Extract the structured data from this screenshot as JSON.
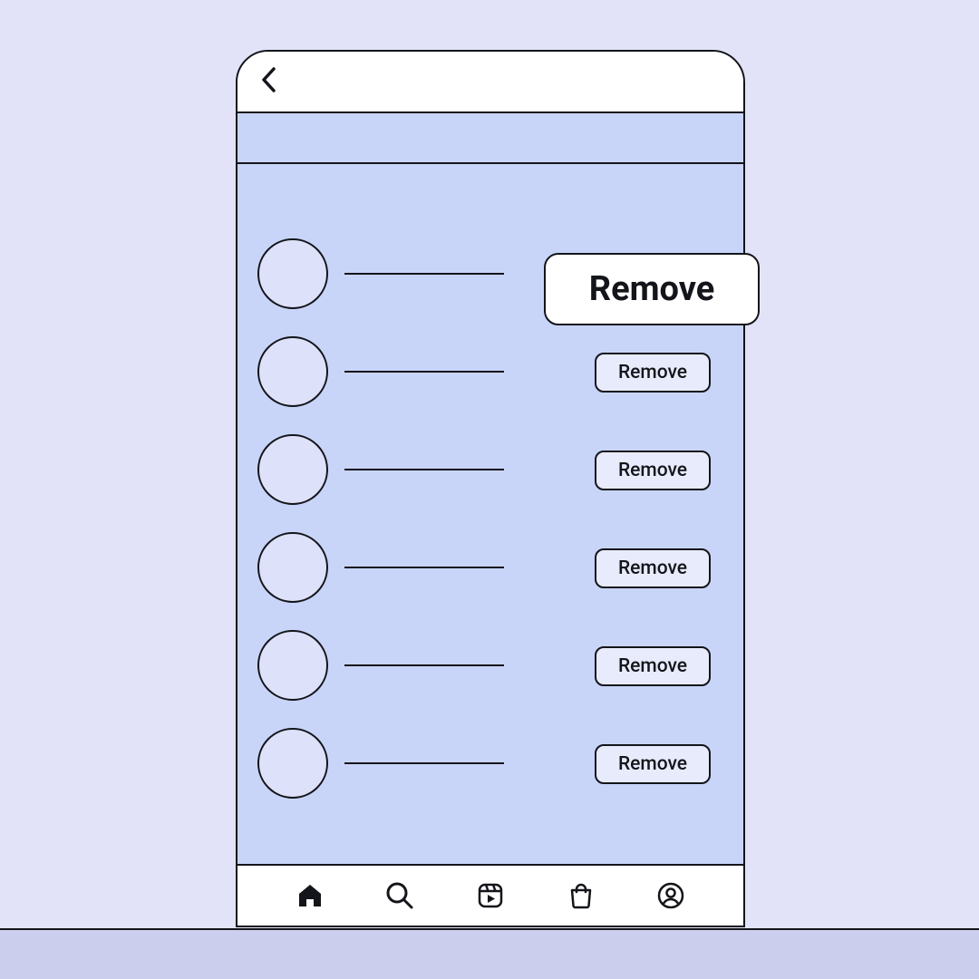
{
  "colors": {
    "page_bg": "#e2e3f8",
    "ground": "#ccceed",
    "phone_accent": "#c8d5f9",
    "avatar_fill": "#dde1fa",
    "button_fill": "#e7ebfb",
    "callout_fill": "#ffffff",
    "outline": "#14151a"
  },
  "list": {
    "items": [
      {
        "action_label": "Remove",
        "highlighted": true
      },
      {
        "action_label": "Remove",
        "highlighted": false
      },
      {
        "action_label": "Remove",
        "highlighted": false
      },
      {
        "action_label": "Remove",
        "highlighted": false
      },
      {
        "action_label": "Remove",
        "highlighted": false
      },
      {
        "action_label": "Remove",
        "highlighted": false
      }
    ]
  },
  "callout": {
    "label": "Remove"
  },
  "nav": {
    "items": [
      {
        "name": "home",
        "active": true
      },
      {
        "name": "search",
        "active": false
      },
      {
        "name": "reels",
        "active": false
      },
      {
        "name": "shop",
        "active": false
      },
      {
        "name": "profile",
        "active": false
      }
    ]
  }
}
